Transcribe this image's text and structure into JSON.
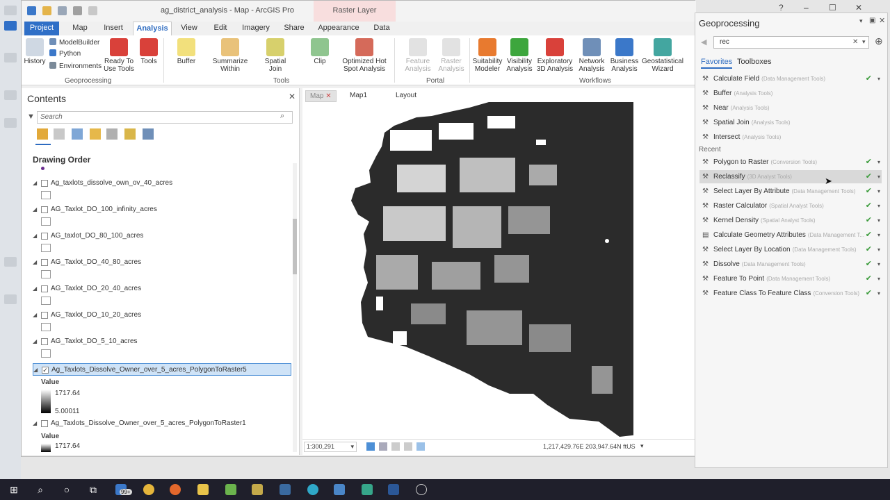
{
  "window": {
    "title": "ag_district_analysis - Map - ArcGIS Pro",
    "context_tab": "Raster Layer"
  },
  "tabs": [
    "Project",
    "Map",
    "Insert",
    "Analysis",
    "View",
    "Edit",
    "Imagery",
    "Share",
    "Appearance",
    "Data"
  ],
  "ribbon": {
    "geoprocessing": {
      "history": "History",
      "modelbuilder": "ModelBuilder",
      "python": "Python",
      "environments": "Environments",
      "ready_to_use": "Ready To Use Tools",
      "tools": "Tools",
      "group": "Geoprocessing"
    },
    "tools": {
      "buffer": "Buffer",
      "summarize_within": "Summarize Within",
      "spatial_join": "Spatial Join",
      "clip": "Clip",
      "optimized_hot_spot": "Optimized Hot Spot Analysis",
      "group": "Tools"
    },
    "portal": {
      "feature_analysis": "Feature Analysis",
      "raster_analysis": "Raster Analysis",
      "group": "Portal"
    },
    "workflows": {
      "suitability": "Suitability Modeler",
      "visibility": "Visibility Analysis",
      "exploratory": "Exploratory 3D Analysis",
      "network": "Network Analysis",
      "business": "Business Analysis",
      "geostatistical": "Geostatistical Wizard",
      "group": "Workflows"
    }
  },
  "contents": {
    "title": "Contents",
    "search_placeholder": "Search",
    "drawing_order": "Drawing Order",
    "layers": [
      {
        "name": "Ag_taxlots_dissolve_own_ov_40_acres",
        "checked": false
      },
      {
        "name": "AG_Taxlot_DO_100_infinity_acres",
        "checked": false
      },
      {
        "name": "AG_taxlot_DO_80_100_acres",
        "checked": false
      },
      {
        "name": "AG_Taxlot_DO_40_80_acres",
        "checked": false
      },
      {
        "name": "AG_Taxlot_DO_20_40_acres",
        "checked": false
      },
      {
        "name": "AG_Taxlot_DO_10_20_acres",
        "checked": false
      },
      {
        "name": "AG_Taxlot_DO_5_10_acres",
        "checked": false
      },
      {
        "name": "Ag_Taxlots_Dissolve_Owner_over_5_acres_PolygonToRaster5",
        "checked": true
      },
      {
        "name": "Ag_Taxlots_Dissolve_Owner_over_5_acres_PolygonToRaster1",
        "checked": false
      }
    ],
    "raster5_legend": {
      "label": "Value",
      "high": "1717.64",
      "low": "5.00011"
    },
    "raster1_legend": {
      "label": "Value",
      "high": "1717.64"
    }
  },
  "mapview": {
    "tabs": [
      "Map",
      "Map1",
      "Layout"
    ],
    "scale": "1:300,291",
    "coords": "1,217,429.76E 203,947.64N ftUS"
  },
  "geoprocessing": {
    "title": "Geoprocessing",
    "search_value": "rec",
    "tab_favorites": "Favorites",
    "tab_toolboxes": "Toolboxes",
    "recent_label": "Recent",
    "favorites": [
      {
        "name": "Calculate Field",
        "box": "(Data Management Tools)",
        "check": true
      },
      {
        "name": "Buffer",
        "box": "(Analysis Tools)",
        "check": false
      },
      {
        "name": "Near",
        "box": "(Analysis Tools)",
        "check": false
      },
      {
        "name": "Spatial Join",
        "box": "(Analysis Tools)",
        "check": false
      },
      {
        "name": "Intersect",
        "box": "(Analysis Tools)",
        "check": false
      }
    ],
    "recent": [
      {
        "name": "Polygon to Raster",
        "box": "(Conversion Tools)",
        "check": true
      },
      {
        "name": "Reclassify",
        "box": "(3D Analyst Tools)",
        "check": true,
        "highlight": true
      },
      {
        "name": "Select Layer By Attribute",
        "box": "(Data Management Tools)",
        "check": true
      },
      {
        "name": "Raster Calculator",
        "box": "(Spatial Analyst Tools)",
        "check": true
      },
      {
        "name": "Kernel Density",
        "box": "(Spatial Analyst Tools)",
        "check": true
      },
      {
        "name": "Calculate Geometry Attributes",
        "box": "(Data Management T...",
        "check": true
      },
      {
        "name": "Select Layer By Location",
        "box": "(Data Management Tools)",
        "check": true
      },
      {
        "name": "Dissolve",
        "box": "(Data Management Tools)",
        "check": true
      },
      {
        "name": "Feature To Point",
        "box": "(Data Management Tools)",
        "check": true
      },
      {
        "name": "Feature Class To Feature Class",
        "box": "(Conversion Tools)",
        "check": true
      }
    ]
  },
  "taskbar": {
    "badge": "99+"
  },
  "colors": {
    "accent": "#2d6bc0",
    "project_tab": "#2f6fc7",
    "selection": "#cfe3f7",
    "map_fill": "#2b2b2b"
  }
}
